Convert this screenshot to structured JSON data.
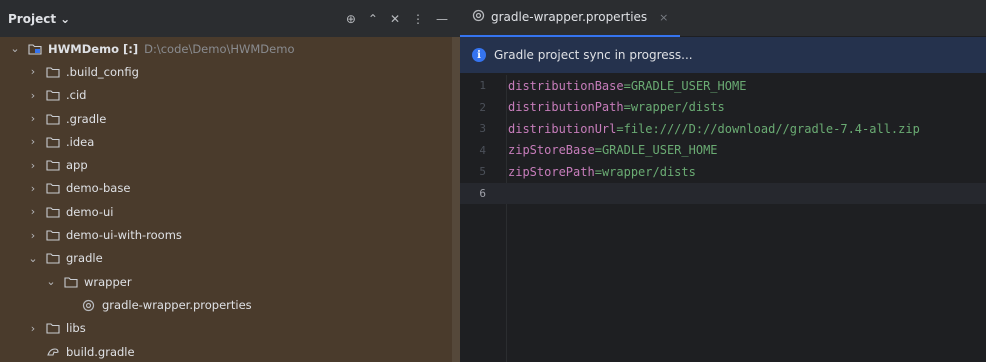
{
  "project_panel": {
    "title": "Project",
    "title_chevron": "⌄",
    "tools": [
      "⊕",
      "⌃",
      "✕",
      "⋮",
      "—"
    ],
    "tree": [
      {
        "indent": 0,
        "chevron": "⌄",
        "icon": "module-icon",
        "label": "HWMDemo [:]",
        "path": "D:\\code\\Demo\\HWMDemo",
        "bold": true
      },
      {
        "indent": 1,
        "chevron": "›",
        "icon": "folder-icon",
        "label": ".build_config"
      },
      {
        "indent": 1,
        "chevron": "›",
        "icon": "folder-icon",
        "label": ".cid"
      },
      {
        "indent": 1,
        "chevron": "›",
        "icon": "folder-icon",
        "label": ".gradle"
      },
      {
        "indent": 1,
        "chevron": "›",
        "icon": "folder-icon",
        "label": ".idea"
      },
      {
        "indent": 1,
        "chevron": "›",
        "icon": "folder-icon",
        "label": "app"
      },
      {
        "indent": 1,
        "chevron": "›",
        "icon": "folder-icon",
        "label": "demo-base"
      },
      {
        "indent": 1,
        "chevron": "›",
        "icon": "folder-icon",
        "label": "demo-ui"
      },
      {
        "indent": 1,
        "chevron": "›",
        "icon": "folder-icon",
        "label": "demo-ui-with-rooms"
      },
      {
        "indent": 1,
        "chevron": "⌄",
        "icon": "folder-icon",
        "label": "gradle"
      },
      {
        "indent": 2,
        "chevron": "⌄",
        "icon": "folder-icon",
        "label": "wrapper"
      },
      {
        "indent": 3,
        "chevron": "",
        "icon": "settings-file-icon",
        "label": "gradle-wrapper.properties"
      },
      {
        "indent": 1,
        "chevron": "›",
        "icon": "folder-icon",
        "label": "libs"
      },
      {
        "indent": 1,
        "chevron": "",
        "icon": "gradle-file-icon",
        "label": "build.gradle"
      }
    ]
  },
  "editor": {
    "tab": {
      "label": "gradle-wrapper.properties",
      "close": "×"
    },
    "banner": {
      "icon": "i",
      "text": "Gradle project sync in progress..."
    },
    "lines": [
      {
        "num": "1",
        "key": "distributionBase",
        "eq": "=",
        "value": "GRADLE_USER_HOME"
      },
      {
        "num": "2",
        "key": "distributionPath",
        "eq": "=",
        "value": "wrapper/dists"
      },
      {
        "num": "3",
        "key": "distributionUrl",
        "eq": "=",
        "value": "file:////D://download//gradle-7.4-all.zip"
      },
      {
        "num": "4",
        "key": "zipStoreBase",
        "eq": "=",
        "value": "GRADLE_USER_HOME"
      },
      {
        "num": "5",
        "key": "zipStorePath",
        "eq": "=",
        "value": "wrapper/dists"
      },
      {
        "num": "6",
        "key": "",
        "eq": "",
        "value": ""
      }
    ]
  }
}
